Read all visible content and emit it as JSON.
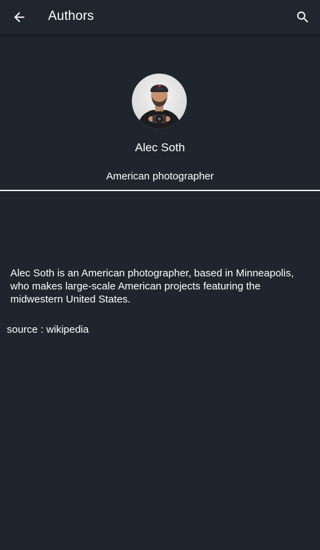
{
  "app_bar": {
    "title": "Authors",
    "back_icon": "arrow-back-icon",
    "search_icon": "search-icon"
  },
  "author": {
    "name": "Alec Soth",
    "description": "American photographer",
    "bio": "Alec Soth is an American photographer, based in Minneapolis, who makes large-scale American projects featuring the midwestern United States.",
    "source": "source : wikipedia"
  },
  "colors": {
    "background": "#1f252c",
    "text": "#ffffff",
    "divider": "#e9e9e9"
  }
}
